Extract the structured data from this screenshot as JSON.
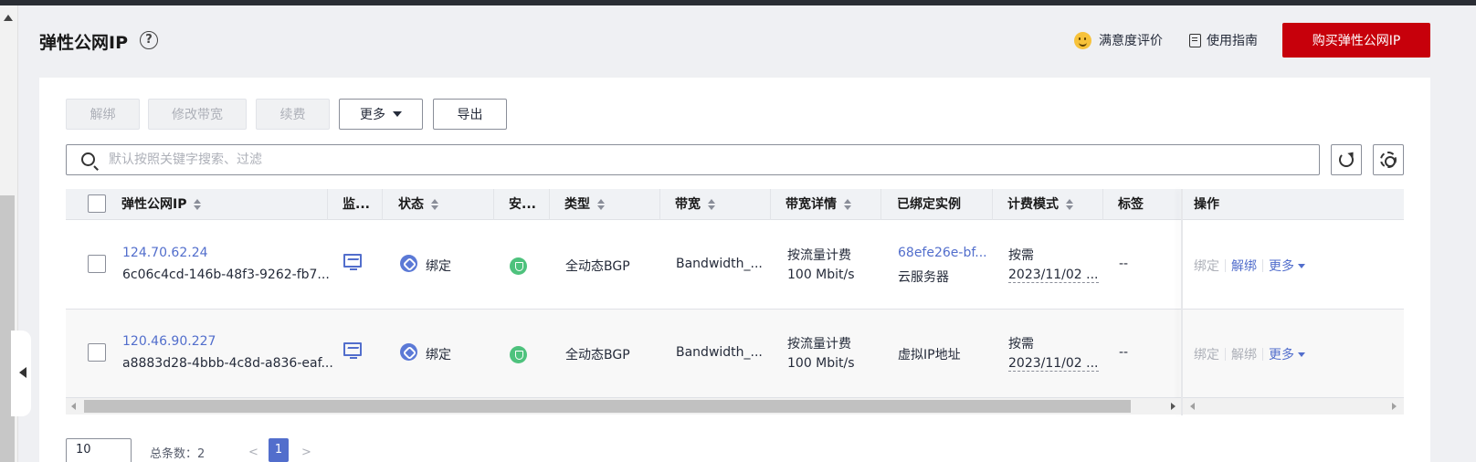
{
  "header": {
    "title": "弹性公网IP",
    "satisfaction": "满意度评价",
    "guide": "使用指南",
    "buy_button": "购买弹性公网IP"
  },
  "toolbar": {
    "unbind": "解绑",
    "modify_bandwidth": "修改带宽",
    "renew": "续费",
    "more": "更多",
    "export": "导出"
  },
  "search": {
    "placeholder": "默认按照关键字搜索、过滤"
  },
  "table": {
    "columns": {
      "eip": "弹性公网IP",
      "monitor": "监...",
      "status": "状态",
      "security": "安...",
      "type": "类型",
      "bandwidth": "带宽",
      "bandwidth_detail": "带宽详情",
      "bound_instance": "已绑定实例",
      "billing": "计费模式",
      "tags": "标签",
      "actions": "操作"
    },
    "rows": [
      {
        "ip": "124.70.62.24",
        "id": "6c06c4cd-146b-48f3-9262-fb7...",
        "status": "绑定",
        "type": "全动态BGP",
        "bandwidth": "Bandwidth_...",
        "bw_mode": "按流量计费",
        "bw_size": "100 Mbit/s",
        "instance": "68efe26e-bf...",
        "instance_type": "云服务器",
        "billing": "按需",
        "billing_date": "2023/11/02 ...",
        "tags": "--",
        "op_bind": "绑定",
        "op_unbind": "解绑",
        "op_more": "更多"
      },
      {
        "ip": "120.46.90.227",
        "id": "a8883d28-4bbb-4c8d-a836-eaf...",
        "status": "绑定",
        "type": "全动态BGP",
        "bandwidth": "Bandwidth_...",
        "bw_mode": "按流量计费",
        "bw_size": "100 Mbit/s",
        "instance": "",
        "instance_type": "虚拟IP地址",
        "billing": "按需",
        "billing_date": "2023/11/02 ...",
        "tags": "--",
        "op_bind": "绑定",
        "op_unbind": "解绑",
        "op_more": "更多"
      }
    ]
  },
  "pagination": {
    "page_size": "10",
    "total": "总条数：2",
    "prev": "<",
    "current": "1",
    "next": ">"
  },
  "colors": {
    "brand_red": "#c7000b",
    "link_blue": "#526ecc",
    "status_green": "#4ec27d"
  }
}
